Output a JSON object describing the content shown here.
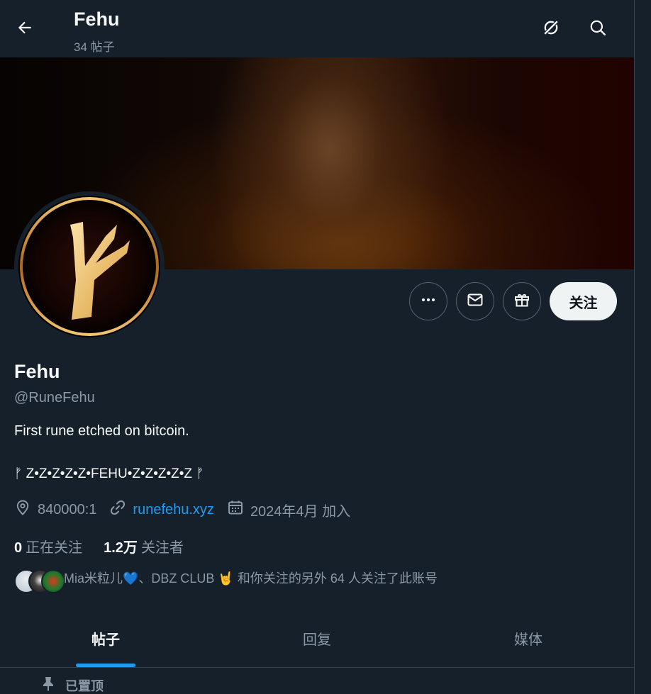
{
  "header": {
    "title": "Fehu",
    "subtitle": "34 帖子"
  },
  "actions": {
    "follow_label": "关注"
  },
  "profile": {
    "name": "Fehu",
    "handle": "@RuneFehu",
    "bio": "First rune etched on bitcoin.",
    "bio_line2": "ᚠ Z•Z•Z•Z•Z•FEHU•Z•Z•Z•Z•Z ᚠ",
    "location": "840000:1",
    "website": "runefehu.xyz",
    "joined": "2024年4月 加入"
  },
  "stats": {
    "following_count": "0",
    "following_label": "正在关注",
    "followers_count": "1.2万",
    "followers_label": "关注者"
  },
  "known_followers": {
    "text": "Mia米粒儿💙、DBZ CLUB 🤘 和你关注的另外 64 人关注了此账号"
  },
  "tabs": [
    {
      "label": "帖子",
      "active": true
    },
    {
      "label": "回复",
      "active": false
    },
    {
      "label": "媒体",
      "active": false
    }
  ],
  "pinned": {
    "label": "已置顶"
  },
  "colors": {
    "background": "#15202b",
    "accent": "#1d9bf0",
    "muted_text": "#8b98a5",
    "primary_text": "#f7f9f9"
  }
}
